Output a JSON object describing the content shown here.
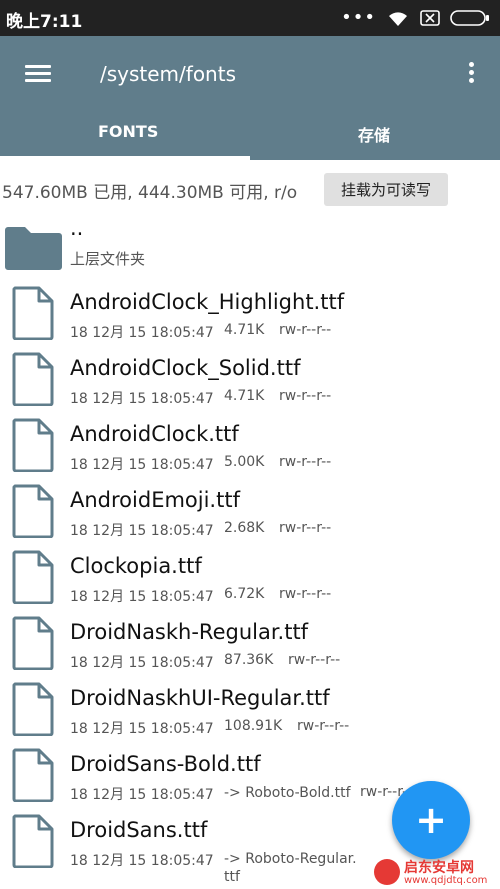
{
  "statusbar": {
    "time": "晚上7:11",
    "icons": [
      "signal-dots-icon",
      "wifi-icon",
      "sim-disabled-icon",
      "battery-icon"
    ]
  },
  "appbar": {
    "title": "/system/fonts",
    "tabs": [
      {
        "label": "FONTS",
        "selected": true
      },
      {
        "label": "存储",
        "selected": false
      }
    ],
    "color": "#607d8b"
  },
  "storage": {
    "summary": "547.60MB 已用, 444.30MB 可用, r/o",
    "mount_label": "挂载为可读写"
  },
  "parent": {
    "name": "..",
    "subtitle": "上层文件夹"
  },
  "files": [
    {
      "name": "AndroidClock_Highlight.ttf",
      "date": "18 12月 15 18:05:47",
      "size": "4.71K",
      "perm": "rw-r--r--"
    },
    {
      "name": "AndroidClock_Solid.ttf",
      "date": "18 12月 15 18:05:47",
      "size": "4.71K",
      "perm": "rw-r--r--"
    },
    {
      "name": "AndroidClock.ttf",
      "date": "18 12月 15 18:05:47",
      "size": "5.00K",
      "perm": "rw-r--r--"
    },
    {
      "name": "AndroidEmoji.ttf",
      "date": "18 12月 15 18:05:47",
      "size": "2.68K",
      "perm": "rw-r--r--"
    },
    {
      "name": "Clockopia.ttf",
      "date": "18 12月 15 18:05:47",
      "size": "6.72K",
      "perm": "rw-r--r--"
    },
    {
      "name": "DroidNaskh-Regular.ttf",
      "date": "18 12月 15 18:05:47",
      "size": "87.36K",
      "perm": "rw-r--r--"
    },
    {
      "name": "DroidNaskhUI-Regular.ttf",
      "date": "18 12月 15 18:05:47",
      "size": "108.91K",
      "perm": "rw-r--r--"
    },
    {
      "name": "DroidSans-Bold.ttf",
      "date": "18 12月 15 18:05:47",
      "link": "-> Roboto-Bold.ttf",
      "perm": "rw-r--r--"
    },
    {
      "name": "DroidSans.ttf",
      "date": "18 12月 15 18:05:47",
      "link": "-> Roboto-Regular.ttf",
      "perm": ""
    }
  ],
  "fab": {
    "label": "+",
    "color": "#2196f3"
  },
  "watermark": {
    "title": "启东安卓网",
    "url": "www.qdjdtq.com"
  }
}
